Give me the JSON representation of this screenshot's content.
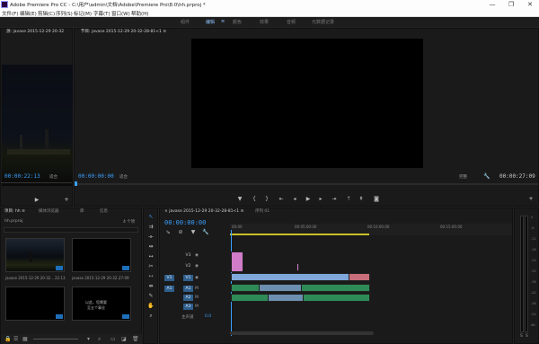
{
  "window": {
    "title": "Adobe Premiere Pro CC - C:\\用户\\admin\\文档\\Adobe\\Premiere Pro\\8.0\\hh.prproj *",
    "minimize": "—",
    "maximize": "❐",
    "close": "✕"
  },
  "menu": [
    "文件(F)",
    "编辑(E)",
    "剪辑(C)",
    "序列(S)",
    "标记(M)",
    "字幕(T)",
    "窗口(W)",
    "帮助(H)"
  ],
  "workspaces": {
    "items": [
      "组件",
      "编辑",
      "颜色",
      "效果",
      "音频",
      "元数据记录"
    ],
    "active": "编辑",
    "active_marker": "≡"
  },
  "source_monitor": {
    "tab_label": "源: javase 2015-12-29 20-32",
    "timecode": "00:00:22:13",
    "fit": "适合"
  },
  "program_monitor": {
    "tab_label": "节目: javase 2015-12-29 20-32-28-81<1 ≡",
    "timecode_left": "00:00:00:00",
    "fit_left": "适合",
    "fit_right": "完整",
    "timecode_right": "00:00:27:09"
  },
  "project_panel": {
    "tabs": [
      "项目: hh ≡",
      "媒体浏览器",
      "库",
      "信息"
    ],
    "file": "hh.prproj",
    "count": "4 个项",
    "thumbnails": [
      {
        "name": "javase 2015-12-29 20-32...",
        "duration": "22:13"
      },
      {
        "name": "javase 2015-12-29 20-32...",
        "duration": "27:09"
      },
      {
        "name": "",
        "duration": ""
      },
      {
        "name": "",
        "text": "以此，您需要\n至五个事业"
      }
    ]
  },
  "timeline": {
    "tabs": [
      "× javase 2015-12-29 20-32-28-81<1 ≡",
      "序列 01"
    ],
    "timecode": "00:00:00:00",
    "ruler": [
      "00:00",
      "00:05:00:00",
      "00:10:00:00",
      "00:15:00:00"
    ],
    "tracks": [
      {
        "id": "V3",
        "target": ""
      },
      {
        "id": "V2",
        "target": ""
      },
      {
        "id": "V1",
        "target": "V1"
      },
      {
        "id": "A1",
        "target": "A1"
      },
      {
        "id": "A2",
        "target": ""
      },
      {
        "id": "A3",
        "target": ""
      }
    ],
    "master": "主声道",
    "master_value": "0.0"
  },
  "meter": {
    "scale": [
      "0",
      "-6",
      "-12",
      "-18",
      "-24",
      "-30",
      "-36",
      "-42",
      "-48",
      "-54",
      "dB"
    ],
    "labels": [
      "S",
      "S"
    ]
  },
  "colors": {
    "accent_blue": "#3aa0ff",
    "video_clip": "#7fa7d9",
    "audio_clip": "#2e8b57",
    "title_clip": "#d17cc9",
    "work_area": "#c9c02a"
  }
}
